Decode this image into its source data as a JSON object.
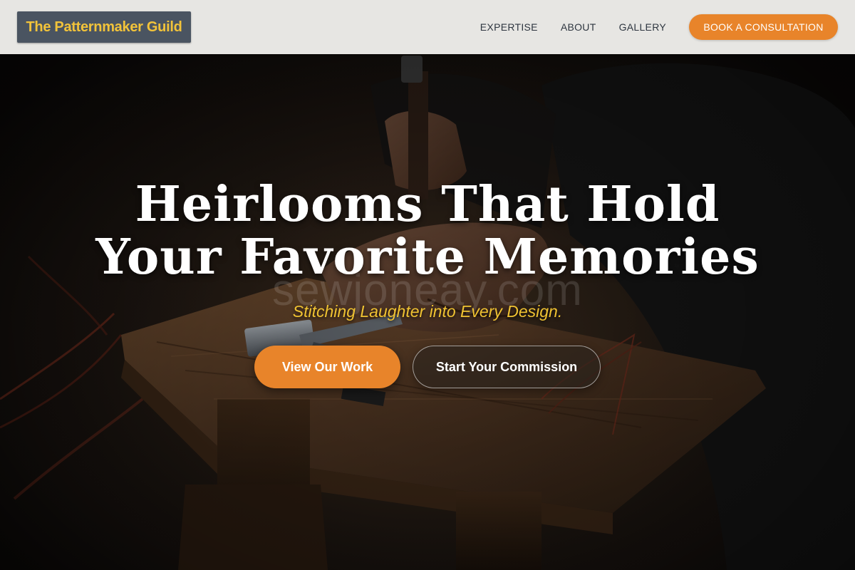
{
  "header": {
    "logo_text": "The Patternmaker Guild",
    "nav_items": [
      {
        "label": "EXPERTISE"
      },
      {
        "label": "ABOUT"
      },
      {
        "label": "GALLERY"
      }
    ],
    "cta_label": "BOOK A CONSULTATION"
  },
  "hero": {
    "title_line1": "Heirlooms That Hold",
    "title_line2": "Your Favorite Memories",
    "subtitle": "Stitching Laughter into Every Design.",
    "primary_button": "View Our Work",
    "secondary_button": "Start Your Commission",
    "background_image": "artisan-hands-hammering-on-wooden-workbench"
  },
  "watermark": "sewjoneay.com",
  "colors": {
    "accent_orange": "#e8842a",
    "logo_bg": "#4a5461",
    "logo_text": "#f2c33a",
    "subtitle_gold": "#efc232",
    "header_bg": "#eeedea",
    "nav_text": "#2e3640"
  }
}
